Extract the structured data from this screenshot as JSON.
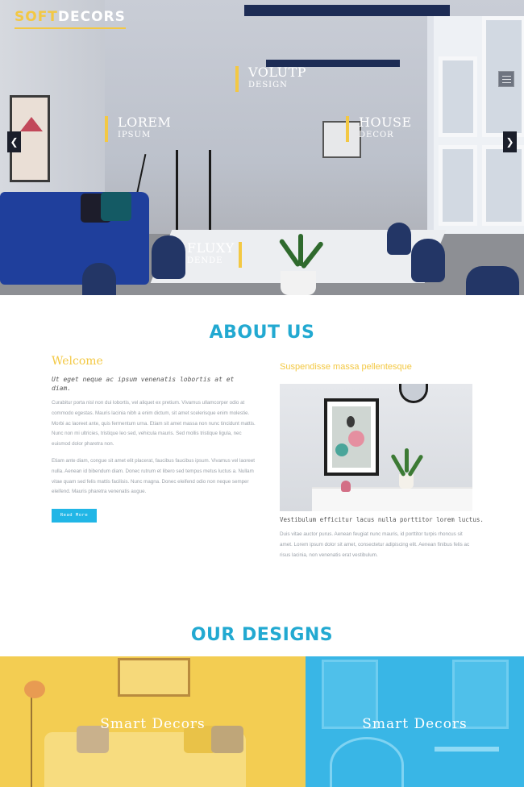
{
  "brand": {
    "part1": "SOFT",
    "part2": "DECORS"
  },
  "hero": {
    "labels": [
      {
        "title": "VOLUTP",
        "sub": "DESIGN"
      },
      {
        "title": "LOREM",
        "sub": "IPSUM"
      },
      {
        "title": "HOUSE",
        "sub": "DECOR"
      },
      {
        "title": "FLUXY",
        "sub": "DENDE"
      }
    ],
    "prev_glyph": "❮",
    "next_glyph": "❯"
  },
  "about": {
    "title": "ABOUT US",
    "welcome": "Welcome",
    "welcome_sub": "Ut eget neque ac ipsum venenatis lobortis at et diam.",
    "paragraph1": "Curabitur porta nisl non dui lobortis, vel aliquet ex pretium. Vivamus ullamcorper odio at commodo egestas. Mauris lacinia nibh a enim dictum, sit amet scelerisque enim molestie. Morbi ac laoreet ante, quis fermentum urna. Etiam sit amet massa non nunc tincidunt mattis. Nunc non mi ultricies, tristique leo sed, vehicula mauris. Sed mollis tristique ligula, nec euismod dolor pharetra non.",
    "paragraph2": "Etiam ante diam, congue sit amet elit placerat, faucibus faucibus ipsum. Vivamus vel laoreet nulla. Aenean id bibendum diam. Donec rutrum et libero sed tempus metus luctus a. Nullam vitae quam sed felis mattis facilisis. Nunc magna. Donec eleifend odio non neque semper eleifend. Mauris pharetra venenatis augue.",
    "read_more": "Read More",
    "right_title": "Suspendisse massa pellentesque",
    "caption": "Vestibulum efficitur lacus nulla porttitor lorem luctus.",
    "paragraph3": "Duis vitae auctor purus. Aenean feugiat nunc mauris, id porttitor turpis rhoncus sit amet. Lorem ipsum dolor sit amet, consectetur adipiscing elit. Aenean finibus felis ac risus lacinia, non venenatis erat vestibulum."
  },
  "designs": {
    "title": "OUR DESIGNS",
    "cards": [
      {
        "label": "Smart Decors",
        "color": "#f3cd52"
      },
      {
        "label": "Smart Decors",
        "color": "#39b6e6"
      }
    ]
  },
  "colors": {
    "accent": "#f3c843",
    "heading": "#22a9d1",
    "button": "#21b6e6",
    "navy": "#1f3f9c"
  }
}
